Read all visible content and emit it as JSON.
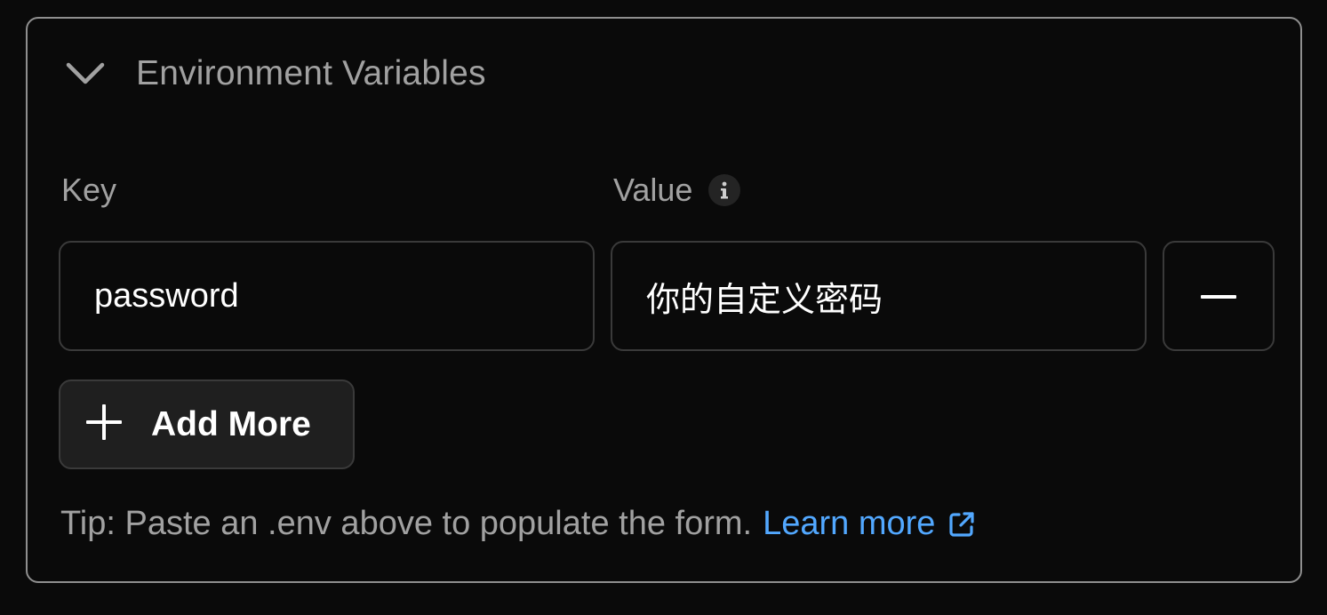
{
  "section": {
    "title": "Environment Variables",
    "expanded": true
  },
  "labels": {
    "key": "Key",
    "value": "Value"
  },
  "row": {
    "key": "password",
    "value": "你的自定义密码"
  },
  "buttons": {
    "add_more": "Add More"
  },
  "tip": {
    "text": "Tip: Paste an .env above to populate the form.",
    "link": "Learn more"
  },
  "icons": {
    "chevron": "chevron-down-icon",
    "info": "info-icon",
    "remove": "minus-icon",
    "add": "plus-icon",
    "external": "external-link-icon"
  },
  "colors": {
    "background": "#0a0a0a",
    "border": "#8f8f8f",
    "muted_text": "#a1a1a1",
    "link": "#52a8ff",
    "button_bg": "#1f1f1f"
  }
}
